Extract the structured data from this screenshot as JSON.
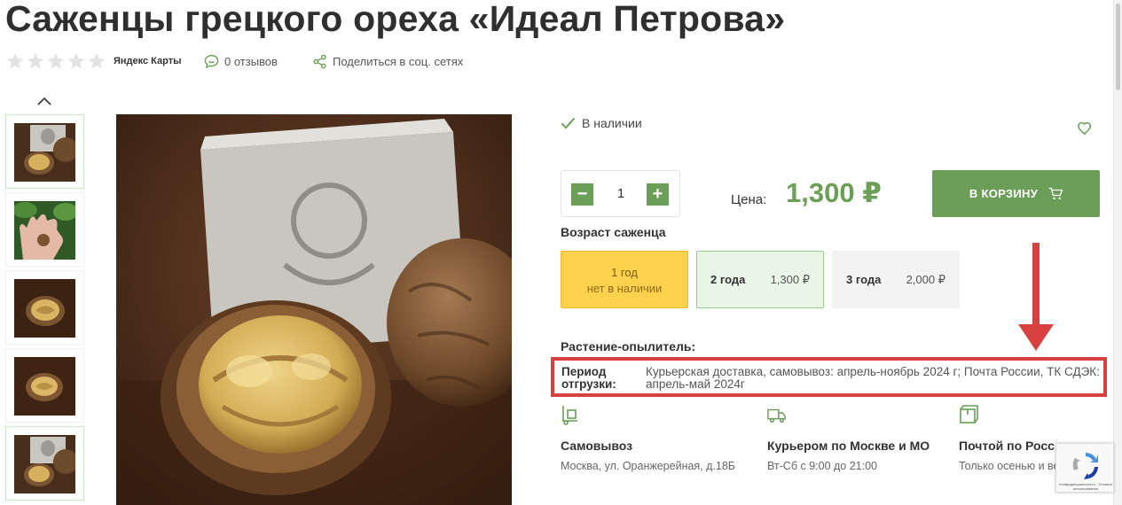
{
  "product": {
    "title": "Саженцы грецкого ореха «Идеал Петрова»",
    "rating_source": "Яндекс Карты",
    "reviews": "0 отзывов",
    "share": "Поделиться в соц. сетях",
    "stock": "В наличии",
    "quantity": "1",
    "price_label": "Цена:",
    "price": "1,300 ₽",
    "cart_button": "В КОРЗИНУ",
    "stars_rating": 0
  },
  "age": {
    "label": "Возраст саженца",
    "options": [
      {
        "name": "1 год",
        "status": "нет в наличии",
        "price": ""
      },
      {
        "name": "2 года",
        "status": "",
        "price": "1,300 ₽"
      },
      {
        "name": "3 года",
        "status": "",
        "price": "2,000 ₽"
      }
    ]
  },
  "pollinator_label": "Растение-опылитель:",
  "shipping": {
    "label": "Период отгрузки:",
    "text": "Курьерская доставка, самовывоз: апрель-ноябрь 2024 г; Почта России, ТК СДЭК: апрель-май 2024г"
  },
  "delivery": [
    {
      "title": "Самовывоз",
      "sub": "Москва, ул. Оранжерейная, д.18Б",
      "icon": "pickup-icon"
    },
    {
      "title": "Курьером по Москве и МО",
      "sub": "Вт-Сб с 9:00 до 21:00",
      "icon": "truck-icon"
    },
    {
      "title": "Почтой по России",
      "sub": "Только осенью и весной",
      "icon": "parcel-icon"
    }
  ],
  "recaptcha_text": "Конфиденциальность - Условия использования",
  "colors": {
    "accent": "#6b9e57",
    "highlight": "#d94040",
    "unavailable": "#ffd24d"
  }
}
